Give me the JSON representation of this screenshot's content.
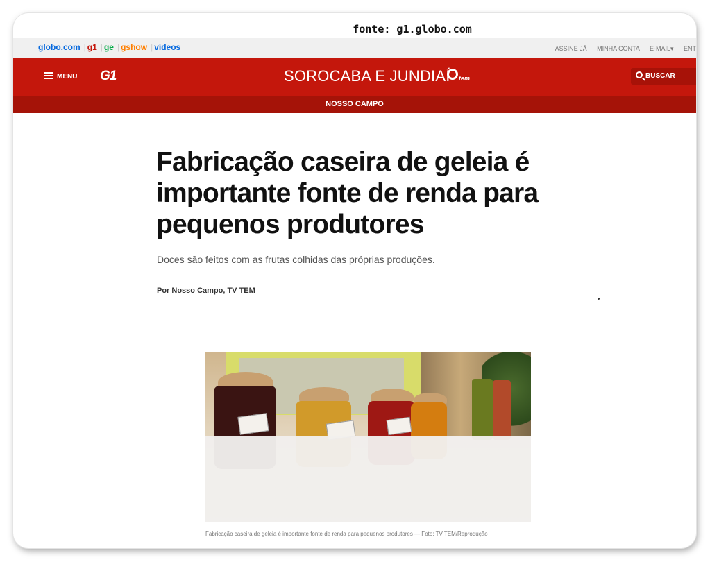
{
  "caption_top": "fonte: g1.globo.com",
  "portal_links": [
    "globo.com",
    "g1",
    "ge",
    "gshow",
    "vídeos"
  ],
  "user_links": [
    "ASSINE JÁ",
    "MINHA CONTA",
    "E-MAIL▾",
    "ENT"
  ],
  "header": {
    "menu_label": "MENU",
    "logo": "G1",
    "region": "SOROCABA E JUNDIAÍ",
    "affiliate_logo": "tem",
    "search_label": "BUSCAR"
  },
  "subnav": {
    "section": "NOSSO CAMPO"
  },
  "article": {
    "title": "Fabricação caseira de geleia é importante fonte de renda para pequenos produtores",
    "subtitle": "Doces são feitos com as frutas colhidas das próprias produções.",
    "byline": "Por Nosso Campo, TV TEM",
    "photo_caption": "Fabricação caseira de geleia é importante fonte de renda para pequenos produtores — Foto: TV TEM/Reprodução"
  },
  "colors": {
    "brand_red": "#c4170c",
    "subnav_red": "#a51308"
  }
}
